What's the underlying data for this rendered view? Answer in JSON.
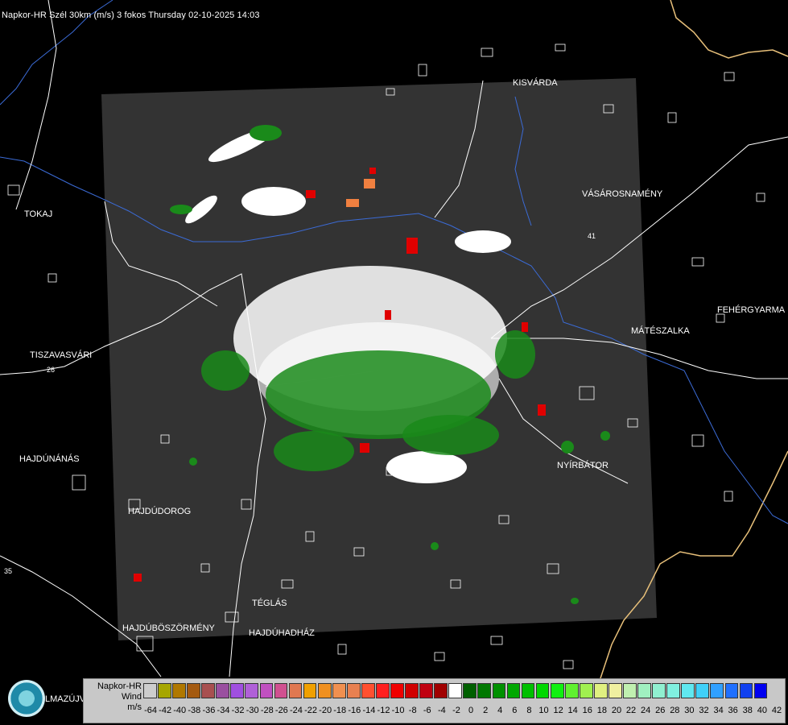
{
  "title": "Napkor-HR Szél 30km (m/s) 3 fokos Thursday 02-10-2025 14:03",
  "cities": [
    {
      "key": "kisvarda",
      "label": "KISVÁRDA"
    },
    {
      "key": "vasarosnameny",
      "label": "VÁSÁROSNAMÉNY"
    },
    {
      "key": "tokaj",
      "label": "TOKAJ"
    },
    {
      "key": "feheryarmat",
      "label": "FEHÉRGYARMA"
    },
    {
      "key": "mateszalka",
      "label": "MÁTÉSZALKA"
    },
    {
      "key": "tiszavasvari",
      "label": "TISZAVASVÁRI"
    },
    {
      "key": "nyirbator",
      "label": "NYÍRBÁTOR"
    },
    {
      "key": "hajdunanas",
      "label": "HAJDÚNÁNÁS"
    },
    {
      "key": "hajdudorog",
      "label": "HAJDÚDOROG"
    },
    {
      "key": "teglas",
      "label": "TÉGLÁS"
    },
    {
      "key": "hajduboszormeny",
      "label": "HAJDÚBÖSZÖRMÉNY"
    },
    {
      "key": "hajduhadhaz",
      "label": "HAJDÚHADHÁZ"
    }
  ],
  "road_numbers": [
    "26",
    "35",
    "41",
    "41"
  ],
  "legend": {
    "line1": "Napkor-HR",
    "line2": "Wind",
    "line3": "m/s",
    "ticks": [
      "-64",
      "-42",
      "-40",
      "-38",
      "-36",
      "-34",
      "-32",
      "-30",
      "-28",
      "-26",
      "-24",
      "-22",
      "-20",
      "-18",
      "-16",
      "-14",
      "-12",
      "-10",
      "-8",
      "-6",
      "-4",
      "-2",
      "0",
      "2",
      "4",
      "6",
      "8",
      "10",
      "12",
      "14",
      "16",
      "18",
      "20",
      "22",
      "24",
      "26",
      "28",
      "30",
      "32",
      "34",
      "36",
      "38",
      "40",
      "42"
    ],
    "colors": [
      "#cdcdcd",
      "#a6a600",
      "#b07800",
      "#a45a10",
      "#a85050",
      "#9a50a0",
      "#a050e0",
      "#b060d8",
      "#c050c0",
      "#d05090",
      "#e07850",
      "#f0a000",
      "#f09020",
      "#f09050",
      "#e88050",
      "#ff5030",
      "#ff2020",
      "#f00000",
      "#d00000",
      "#c00010",
      "#a00000",
      "#ffffff",
      "#006000",
      "#007800",
      "#009000",
      "#00a800",
      "#00c000",
      "#00d800",
      "#10f010",
      "#60f030",
      "#a0f050",
      "#e0f080",
      "#f0f0a0",
      "#c0f0b0",
      "#a0f0c0",
      "#90f0d0",
      "#80f0e0",
      "#60e8f0",
      "#40d0f8",
      "#30a0ff",
      "#2070ff",
      "#1040f0",
      "#0000f0"
    ]
  },
  "logo_text": "LMAZÚJVÁR"
}
